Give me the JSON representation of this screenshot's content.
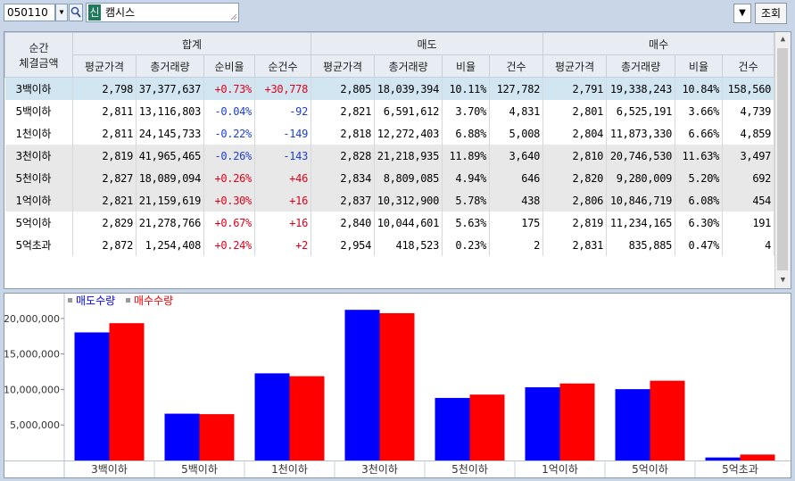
{
  "toolbar": {
    "code": "050110",
    "badge": "신",
    "stock_name": "캠시스",
    "menu_icon": "▼",
    "query_label": "조회"
  },
  "table": {
    "corner_line1": "순간",
    "corner_line2": "체결금액",
    "groups": [
      "합계",
      "매도",
      "매수"
    ],
    "subheaders": [
      "평균가격",
      "총거래량",
      "순비율",
      "순건수",
      "평균가격",
      "총거래량",
      "비율",
      "건수",
      "평균가격",
      "총거래량",
      "비율",
      "건수"
    ],
    "rows": [
      {
        "label": "3백이하",
        "cells": [
          "2,798",
          "37,377,637",
          "+0.73%",
          "+30,778",
          "2,805",
          "18,039,394",
          "10.11%",
          "127,782",
          "2,791",
          "19,338,243",
          "10.84%",
          "158,560"
        ]
      },
      {
        "label": "5백이하",
        "cells": [
          "2,811",
          "13,116,803",
          "-0.04%",
          "-92",
          "2,821",
          "6,591,612",
          "3.70%",
          "4,831",
          "2,801",
          "6,525,191",
          "3.66%",
          "4,739"
        ]
      },
      {
        "label": "1천이하",
        "cells": [
          "2,811",
          "24,145,733",
          "-0.22%",
          "-149",
          "2,818",
          "12,272,403",
          "6.88%",
          "5,008",
          "2,804",
          "11,873,330",
          "6.66%",
          "4,859"
        ]
      },
      {
        "label": "3천이하",
        "cells": [
          "2,819",
          "41,965,465",
          "-0.26%",
          "-143",
          "2,828",
          "21,218,935",
          "11.89%",
          "3,640",
          "2,810",
          "20,746,530",
          "11.63%",
          "3,497"
        ]
      },
      {
        "label": "5천이하",
        "cells": [
          "2,827",
          "18,089,094",
          "+0.26%",
          "+46",
          "2,834",
          "8,809,085",
          "4.94%",
          "646",
          "2,820",
          "9,280,009",
          "5.20%",
          "692"
        ]
      },
      {
        "label": "1억이하",
        "cells": [
          "2,821",
          "21,159,619",
          "+0.30%",
          "+16",
          "2,837",
          "10,312,900",
          "5.78%",
          "438",
          "2,806",
          "10,846,719",
          "6.08%",
          "454"
        ]
      },
      {
        "label": "5억이하",
        "cells": [
          "2,829",
          "21,278,766",
          "+0.67%",
          "+16",
          "2,840",
          "10,044,601",
          "5.63%",
          "175",
          "2,819",
          "11,234,165",
          "6.30%",
          "191"
        ]
      },
      {
        "label": "5억초과",
        "cells": [
          "2,872",
          "1,254,408",
          "+0.24%",
          "+2",
          "2,954",
          "418,523",
          "0.23%",
          "2",
          "2,831",
          "835,885",
          "0.47%",
          "4"
        ]
      }
    ]
  },
  "chart_data": {
    "type": "bar",
    "categories": [
      "3백이하",
      "5백이하",
      "1천이하",
      "3천이하",
      "5천이하",
      "1억이하",
      "5억이하",
      "5억초과"
    ],
    "series": [
      {
        "name": "매도수량",
        "color": "#0000ff",
        "values": [
          18039394,
          6591612,
          12272403,
          21218935,
          8809085,
          10312900,
          10044601,
          418523
        ]
      },
      {
        "name": "매수수량",
        "color": "#ff0000",
        "values": [
          19338243,
          6525191,
          11873330,
          20746530,
          9280009,
          10846719,
          11234165,
          835885
        ]
      }
    ],
    "yticks": [
      "5,000,000",
      "10,000,000",
      "15,000,000",
      "20,000,000"
    ],
    "ytick_values": [
      5000000,
      10000000,
      15000000,
      20000000
    ],
    "ylim": [
      0,
      22500000
    ],
    "legend": "top-left"
  }
}
